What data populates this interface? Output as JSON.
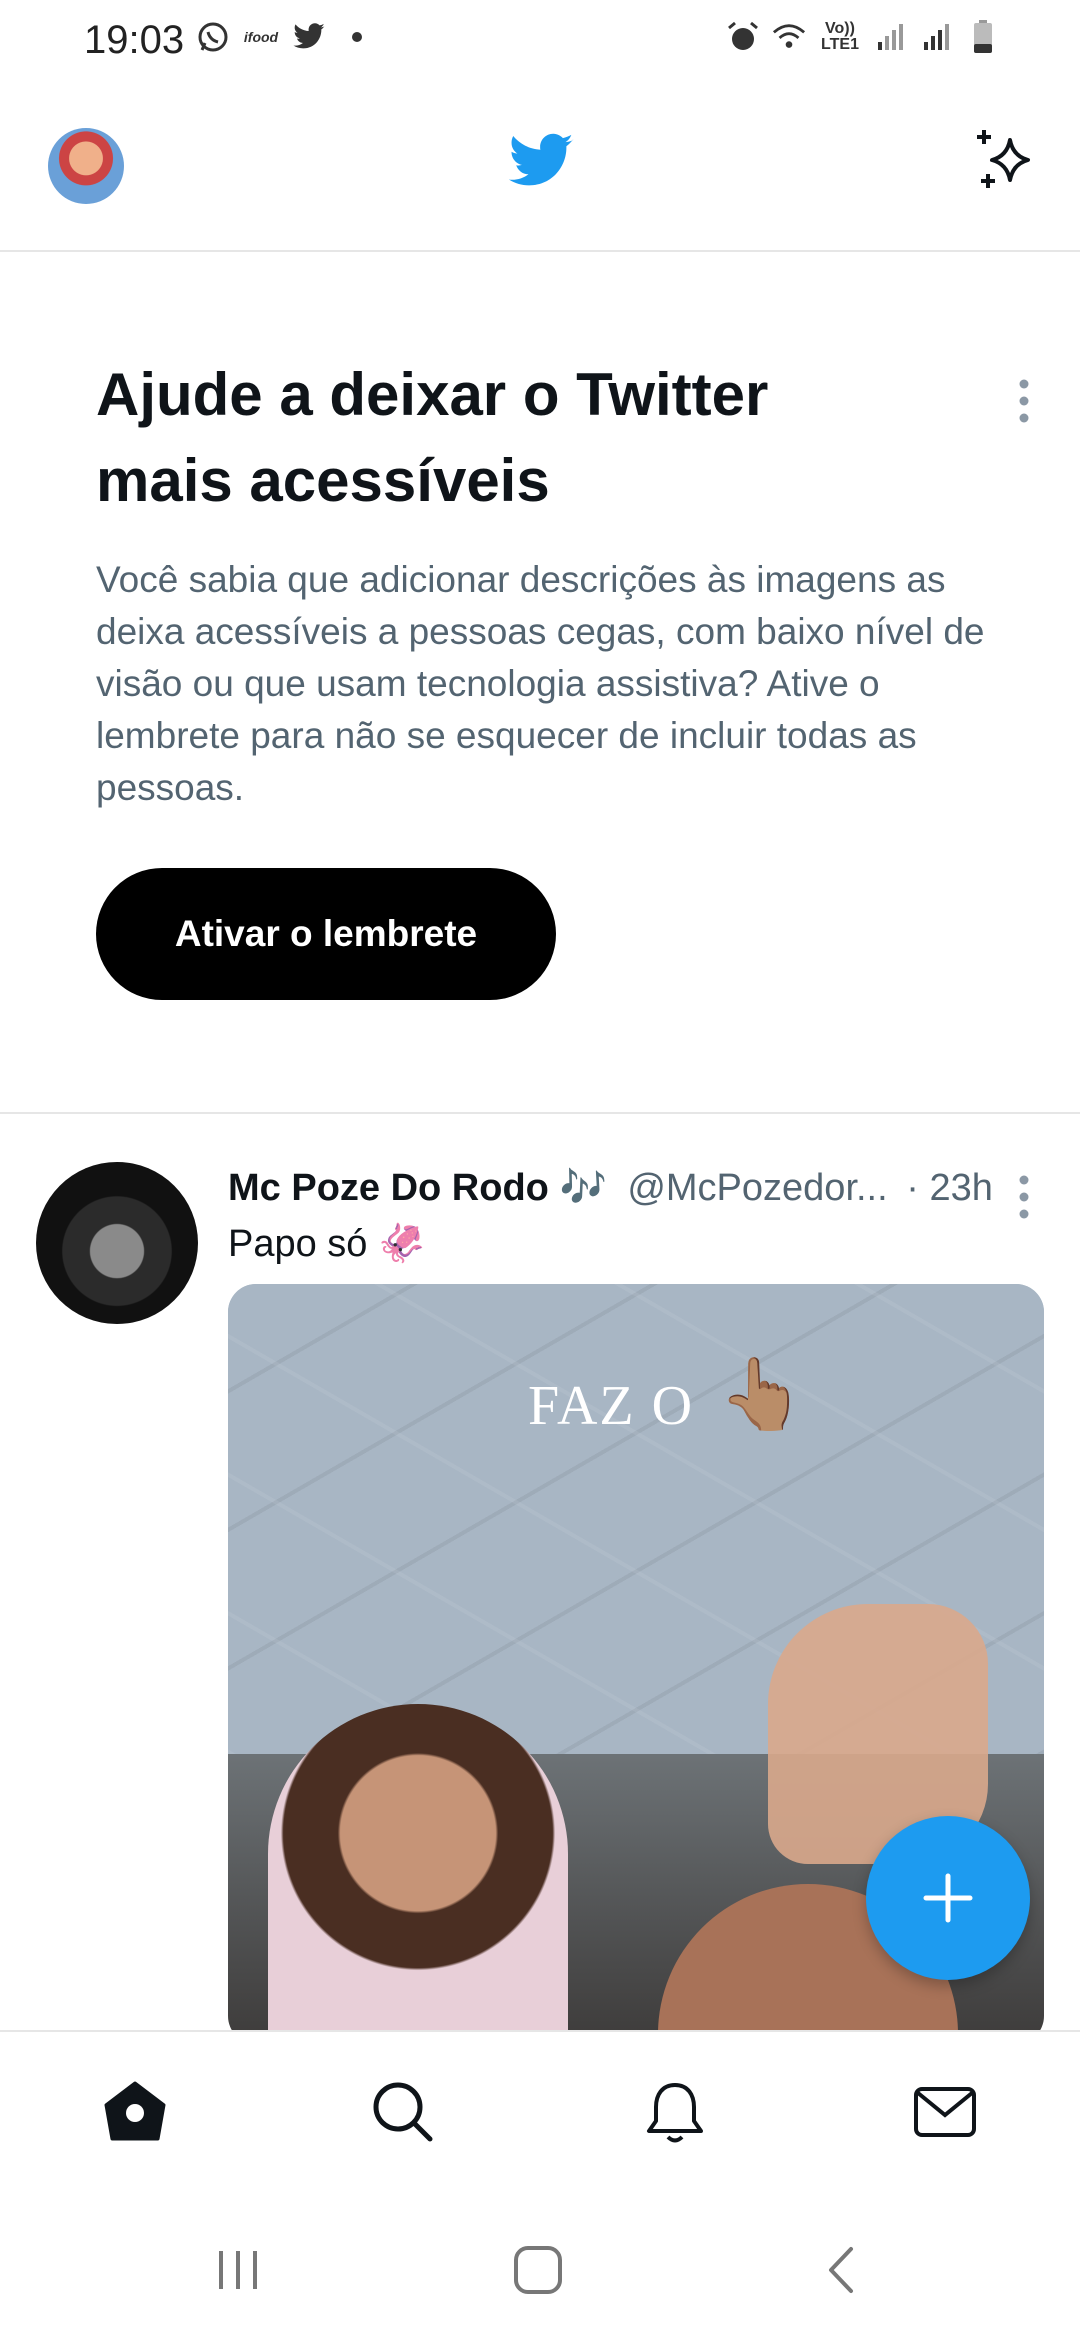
{
  "status_bar": {
    "time": "19:03",
    "left_icons": [
      "whatsapp-icon",
      "ifood-icon",
      "twitter-icon"
    ],
    "ifood_label": "ifood",
    "lte_label": "Vo)) LTE1",
    "right_icons": [
      "alarm-icon",
      "wifi-icon",
      "signal-icon",
      "signal-icon",
      "battery-icon"
    ]
  },
  "header": {
    "logo": "twitter-bird-icon",
    "left": "profile-avatar",
    "right": "sparkle-icon",
    "accent_color": "#1d9bf0"
  },
  "accessibility_prompt": {
    "title": "Ajude a deixar o Twitter mais acessíveis",
    "body": "Você sabia que adicionar descrições às imagens as deixa acessíveis a pessoas cegas, com baixo nível de visão ou que usam tecnologia assistiva? Ative o lembrete para não se esquecer de incluir todas as pessoas.",
    "button_label": "Ativar o lembrete"
  },
  "tweet": {
    "name": "Mc Poze Do Rodo 🎶",
    "handle": "@McPozedor...",
    "time": "· 23h",
    "text": "Papo só 🦑",
    "media_caption": "FAZ O",
    "media_emoji": "👆🏽"
  },
  "bottom_nav": {
    "items": [
      "home-icon",
      "search-icon",
      "notifications-icon",
      "messages-icon"
    ]
  },
  "system_nav": {
    "items": [
      "recent-apps-icon",
      "home-button-icon",
      "back-icon"
    ]
  }
}
